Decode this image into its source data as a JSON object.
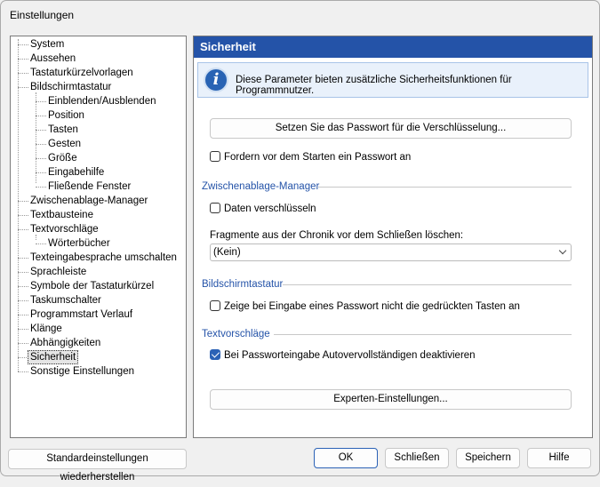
{
  "window": {
    "title": "Einstellungen"
  },
  "sidebar": {
    "items": [
      {
        "label": "System",
        "level": 0
      },
      {
        "label": "Aussehen",
        "level": 0
      },
      {
        "label": "Tastaturkürzelvorlagen",
        "level": 0
      },
      {
        "label": "Bildschirmtastatur",
        "level": 0
      },
      {
        "label": "Einblenden/Ausblenden",
        "level": 1
      },
      {
        "label": "Position",
        "level": 1
      },
      {
        "label": "Tasten",
        "level": 1
      },
      {
        "label": "Gesten",
        "level": 1
      },
      {
        "label": "Größe",
        "level": 1
      },
      {
        "label": "Eingabehilfe",
        "level": 1
      },
      {
        "label": "Fließende Fenster",
        "level": 1
      },
      {
        "label": "Zwischenablage-Manager",
        "level": 0
      },
      {
        "label": "Textbausteine",
        "level": 0
      },
      {
        "label": "Textvorschläge",
        "level": 0
      },
      {
        "label": "Wörterbücher",
        "level": 1
      },
      {
        "label": "Texteingabesprache umschalten",
        "level": 0
      },
      {
        "label": "Sprachleiste",
        "level": 0
      },
      {
        "label": "Symbole der Tastaturkürzel",
        "level": 0
      },
      {
        "label": "Taskumschalter",
        "level": 0
      },
      {
        "label": "Programmstart Verlauf",
        "level": 0
      },
      {
        "label": "Klänge",
        "level": 0
      },
      {
        "label": "Abhängigkeiten",
        "level": 0
      },
      {
        "label": "Sicherheit",
        "level": 0,
        "selected": true
      },
      {
        "label": "Sonstige Einstellungen",
        "level": 0
      }
    ]
  },
  "panel": {
    "title": "Sicherheit",
    "info": "Diese Parameter bieten zusätzliche Sicherheitsfunktionen für Programmnutzer.",
    "set_password_button": "Setzen Sie das Passwort für die Verschlüsselung...",
    "require_password": {
      "label": "Fordern vor dem Starten ein Passwort an",
      "checked": false
    },
    "clipboard_section": "Zwischenablage-Manager",
    "encrypt_data": {
      "label": "Daten verschlüsseln",
      "checked": false
    },
    "fragments_label": "Fragmente aus der Chronik vor dem Schließen löschen:",
    "fragments_select": "(Kein)",
    "keyboard_section": "Bildschirmtastatur",
    "hide_keys": {
      "label": "Zeige bei Eingabe eines Passwort nicht die gedrückten Tasten an",
      "checked": false
    },
    "suggestions_section": "Textvorschläge",
    "disable_autocomplete": {
      "label": "Bei Passworteingabe Autovervollständigen deaktivieren",
      "checked": true
    },
    "expert_button": "Experten-Einstellungen..."
  },
  "footer": {
    "restore_defaults": "Standardeinstellungen wiederherstellen",
    "ok": "OK",
    "close": "Schließen",
    "save": "Speichern",
    "help": "Hilfe"
  },
  "colors": {
    "accent": "#2453a8",
    "checkbox_checked": "#2b62b6",
    "info_bg": "#e9f1fb"
  }
}
